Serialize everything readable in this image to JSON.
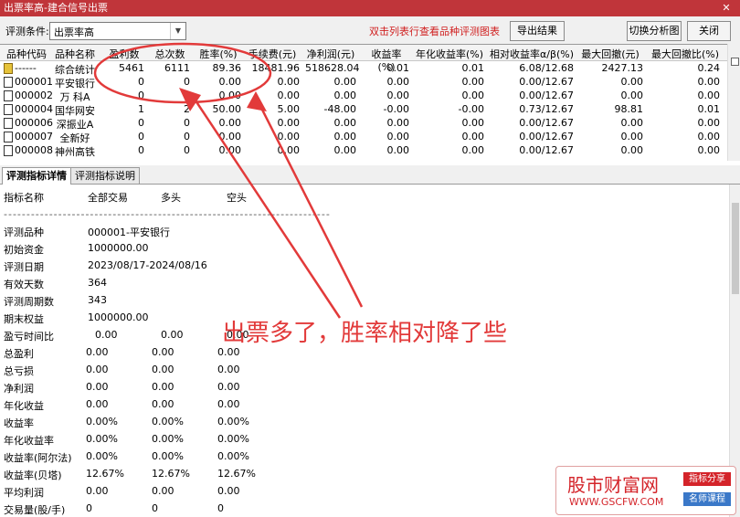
{
  "window": {
    "title": "出票率高-建合信号出票",
    "close_glyph": "✕"
  },
  "toolbar": {
    "condition_label": "评测条件:",
    "condition_value": "出票率高",
    "hint": "双击列表行查看品种评测图表",
    "export_label": "导出结果",
    "switch_label": "切换分析图",
    "close_label": "关闭"
  },
  "table": {
    "headers": [
      "品种代码",
      "品种名称",
      "盈利数",
      "总次数",
      "胜率(%)",
      "手续费(元)",
      "净利润(元)",
      "收益率(%)",
      "年化收益率(%)",
      "相对收益率α/β(%)",
      "最大回撤(元)",
      "最大回撤比(%)"
    ],
    "rows": [
      {
        "icon": "folder",
        "cells": [
          "------",
          "综合统计",
          "5461",
          "6111",
          "89.36",
          "18481.96",
          "518628.04",
          "0.01",
          "0.01",
          "6.08/12.68",
          "2427.13",
          "0.24"
        ]
      },
      {
        "icon": "doc",
        "cells": [
          "000001",
          "平安银行",
          "0",
          "0",
          "0.00",
          "0.00",
          "0.00",
          "0.00",
          "0.00",
          "0.00/12.67",
          "0.00",
          "0.00"
        ]
      },
      {
        "icon": "doc",
        "cells": [
          "000002",
          "万 科A",
          "0",
          "0",
          "0.00",
          "0.00",
          "0.00",
          "0.00",
          "0.00",
          "0.00/12.67",
          "0.00",
          "0.00"
        ]
      },
      {
        "icon": "doc",
        "cells": [
          "000004",
          "国华网安",
          "1",
          "2",
          "50.00",
          "5.00",
          "-48.00",
          "-0.00",
          "-0.00",
          "0.73/12.67",
          "98.81",
          "0.01"
        ]
      },
      {
        "icon": "doc",
        "cells": [
          "000006",
          "深振业A",
          "0",
          "0",
          "0.00",
          "0.00",
          "0.00",
          "0.00",
          "0.00",
          "0.00/12.67",
          "0.00",
          "0.00"
        ]
      },
      {
        "icon": "doc",
        "cells": [
          "000007",
          "全新好",
          "0",
          "0",
          "0.00",
          "0.00",
          "0.00",
          "0.00",
          "0.00",
          "0.00/12.67",
          "0.00",
          "0.00"
        ]
      },
      {
        "icon": "doc",
        "cells": [
          "000008",
          "神州高铁",
          "0",
          "0",
          "0.00",
          "0.00",
          "0.00",
          "0.00",
          "0.00",
          "0.00/12.67",
          "0.00",
          "0.00"
        ]
      }
    ]
  },
  "tabs": [
    "评测指标详情",
    "评测指标说明"
  ],
  "detail": {
    "col_headers": [
      "指标名称",
      "全部交易",
      "多头",
      "空头"
    ],
    "dashes": "------------------------------------------------------------------------",
    "info": [
      {
        "label": "评测品种",
        "value": "000001-平安银行"
      },
      {
        "label": "初始资金",
        "value": "1000000.00"
      },
      {
        "label": "评测日期",
        "value": "2023/08/17-2024/08/16"
      },
      {
        "label": "有效天数",
        "value": "364"
      },
      {
        "label": "评测周期数",
        "value": "343"
      },
      {
        "label": "期末权益",
        "value": "1000000.00"
      }
    ],
    "metrics": [
      {
        "label": "盈亏时间比",
        "v": [
          "0.00",
          "0.00",
          "0.00"
        ]
      },
      {
        "label": "总盈利",
        "v": [
          "0.00",
          "0.00",
          "0.00"
        ]
      },
      {
        "label": "总亏损",
        "v": [
          "0.00",
          "0.00",
          "0.00"
        ]
      },
      {
        "label": "净利润",
        "v": [
          "0.00",
          "0.00",
          "0.00"
        ]
      },
      {
        "label": "年化收益",
        "v": [
          "0.00",
          "0.00",
          "0.00"
        ]
      },
      {
        "label": "收益率",
        "v": [
          "0.00%",
          "0.00%",
          "0.00%"
        ]
      },
      {
        "label": "年化收益率",
        "v": [
          "0.00%",
          "0.00%",
          "0.00%"
        ]
      },
      {
        "label": "收益率(阿尔法)",
        "v": [
          "0.00%",
          "0.00%",
          "0.00%"
        ]
      },
      {
        "label": "收益率(贝塔)",
        "v": [
          "12.67%",
          "12.67%",
          "12.67%"
        ]
      },
      {
        "label": "平均利润",
        "v": [
          "0.00",
          "0.00",
          "0.00"
        ]
      },
      {
        "label": "交易量(股/手)",
        "v": [
          "0",
          "0",
          "0"
        ]
      }
    ]
  },
  "annotation": {
    "text": "出票多了，胜率相对降了些",
    "color": "#e23a3a"
  },
  "watermark": {
    "line1": "股市财富网",
    "line2": "WWW.GSCFW.COM",
    "tag1": "指标分享",
    "tag2": "名师课程"
  },
  "colors": {
    "titlebar": "#c0353a",
    "hint": "#d02020",
    "annotation": "#e23a3a",
    "brand": "#d4242a",
    "tag2": "#3a78c8"
  }
}
